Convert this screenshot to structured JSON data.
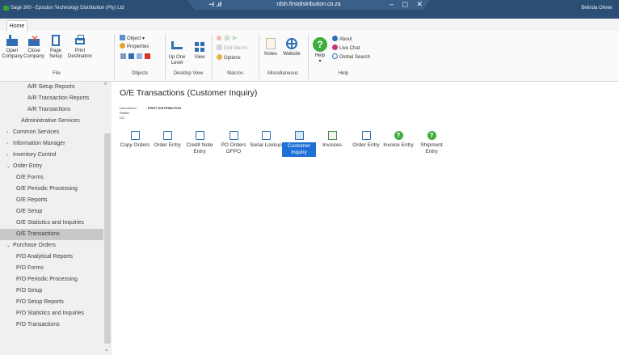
{
  "window": {
    "title": "Sage 300 - Episdon Technology Distribution (Pty) Ltd",
    "user": "Belinda Olivier",
    "remote_host": "rdsh.firstdistribution.co.za"
  },
  "ribbon": {
    "tab": "Home",
    "groups": {
      "file": {
        "label": "File",
        "open": "Open Company",
        "close": "Close Company",
        "page_setup": "Page Setup",
        "print_destination": "Print Destination"
      },
      "objects": {
        "label": "Objects",
        "object": "Object ▾",
        "properties": "Properties"
      },
      "desktop_view": {
        "label": "Desktop View",
        "up_one_level": "Up One Level",
        "view": "View"
      },
      "macros": {
        "label": "Macros",
        "edit_macro": "Edit Macro",
        "options": "Options"
      },
      "miscellaneous": {
        "label": "Miscellaneous",
        "notes": "Notes",
        "website": "Website"
      },
      "help": {
        "label": "Help",
        "help": "Help",
        "about": "About",
        "live_chat": "Live Chat",
        "global_search": "Global Search"
      }
    }
  },
  "sidebar": {
    "items": [
      {
        "label": "A/R Setup Reports",
        "level": 2
      },
      {
        "label": "A/R Transaction Reports",
        "level": 2
      },
      {
        "label": "A/R Transactions",
        "level": 2
      },
      {
        "label": "Administrative Services",
        "level": 1
      },
      {
        "label": "Common Services",
        "level": 0,
        "chevron": "›"
      },
      {
        "label": "Information Manager",
        "level": 0,
        "chevron": "›"
      },
      {
        "label": "Inventory Control",
        "level": 0,
        "chevron": "›"
      },
      {
        "label": "Order Entry",
        "level": 0,
        "chevron": "⌄"
      },
      {
        "label": "O/E Forms",
        "level": 1
      },
      {
        "label": "O/E Periodic Processing",
        "level": 1
      },
      {
        "label": "O/E Reports",
        "level": 1
      },
      {
        "label": "O/E Setup",
        "level": 1
      },
      {
        "label": "O/E Statistics and Inquiries",
        "level": 1
      },
      {
        "label": "O/E Transactions",
        "level": 1,
        "selected": true
      },
      {
        "label": "Purchase Orders",
        "level": 0,
        "chevron": "⌄"
      },
      {
        "label": "P/O Analytical Reports",
        "level": 1
      },
      {
        "label": "P/O Forms",
        "level": 1
      },
      {
        "label": "P/O Periodic Processing",
        "level": 1
      },
      {
        "label": "P/O Setup",
        "level": 1
      },
      {
        "label": "P/O Setup Reports",
        "level": 1
      },
      {
        "label": "P/O Statistics and Inquiries",
        "level": 1
      },
      {
        "label": "P/O Transactions",
        "level": 1
      }
    ]
  },
  "main": {
    "title": "O/E Transactions (Customer Inquiry)",
    "info": {
      "licensed_label": "Licensed to:",
      "licensed_value": ", FIRST DISTRIBUTION",
      "dealer_label": "Dealer:",
      "cc_label": "CC:"
    },
    "tiles": [
      {
        "label": "Copy Orders",
        "icon": "form-icon"
      },
      {
        "label": "Order Entry",
        "icon": "form-icon"
      },
      {
        "label": "Credit Note Entry",
        "icon": "form-icon"
      },
      {
        "label": "PO Orders OFPO",
        "icon": "form-icon"
      },
      {
        "label": "Serial Lookup",
        "icon": "form-icon"
      },
      {
        "label": "Customer Inquiry",
        "icon": "inquiry-icon",
        "selected": true
      },
      {
        "label": "Invoices",
        "icon": "document-icon"
      },
      {
        "label": "Order Entry",
        "icon": "form-icon"
      },
      {
        "label": "Invoice Entry",
        "icon": "help-circle-icon"
      },
      {
        "label": "Shipment Entry",
        "icon": "help-circle-icon"
      }
    ]
  },
  "colors": {
    "titlebar": "#2b4e74",
    "selection": "#1e6fd6",
    "help_green": "#3fae3f",
    "accent_red": "#e0483a"
  }
}
